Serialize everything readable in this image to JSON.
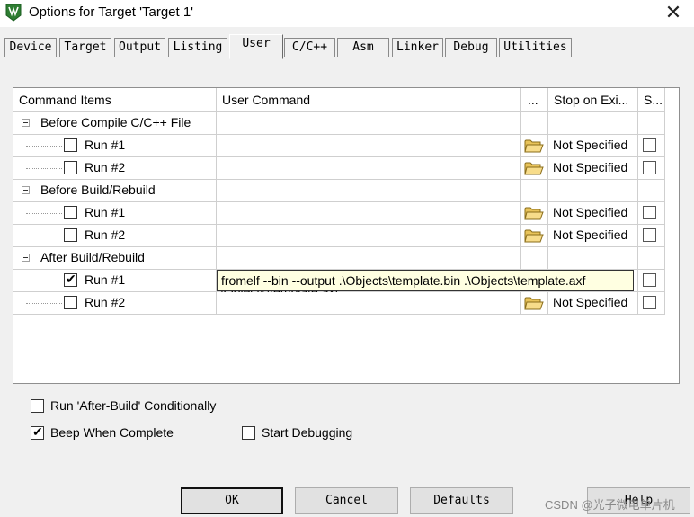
{
  "window": {
    "title": "Options for Target 'Target 1'"
  },
  "tabs": [
    "Device",
    "Target",
    "Output",
    "Listing",
    "User",
    "C/C++",
    "Asm",
    "Linker",
    "Debug",
    "Utilities"
  ],
  "table": {
    "headers": {
      "command_items": "Command Items",
      "user_command": "User Command",
      "browse": "...",
      "stop_on_exit": "Stop on Exi...",
      "s": "S..."
    },
    "groups": [
      {
        "label": "Before Compile C/C++ File",
        "runs": [
          {
            "label": "Run #1",
            "checked": false,
            "command": "",
            "stop": "Not Specified"
          },
          {
            "label": "Run #2",
            "checked": false,
            "command": "",
            "stop": "Not Specified"
          }
        ]
      },
      {
        "label": "Before Build/Rebuild",
        "runs": [
          {
            "label": "Run #1",
            "checked": false,
            "command": "",
            "stop": "Not Specified"
          },
          {
            "label": "Run #2",
            "checked": false,
            "command": "",
            "stop": "Not Specified"
          }
        ]
      },
      {
        "label": "After Build/Rebuild",
        "runs": [
          {
            "label": "Run #1",
            "checked": true,
            "command": "fromelf --bin --output .\\Objects\\template.bin .\\Objects\\template.axf",
            "stop": ""
          },
          {
            "label": "Run #2",
            "checked": false,
            "command": "",
            "stop": "Not Specified"
          }
        ]
      }
    ],
    "tooltip": "fromelf --bin --output .\\Objects\\template.bin .\\Objects\\template.axf"
  },
  "options": {
    "run_after_build": {
      "label": "Run 'After-Build' Conditionally",
      "checked": false
    },
    "beep": {
      "label": "Beep When Complete",
      "checked": true
    },
    "start_debugging": {
      "label": "Start Debugging",
      "checked": false
    }
  },
  "buttons": {
    "ok": "OK",
    "cancel": "Cancel",
    "defaults": "Defaults",
    "help": "Help"
  },
  "watermark": "CSDN @光子微电单片机",
  "check_glyph": "✔",
  "close_glyph": "✕"
}
